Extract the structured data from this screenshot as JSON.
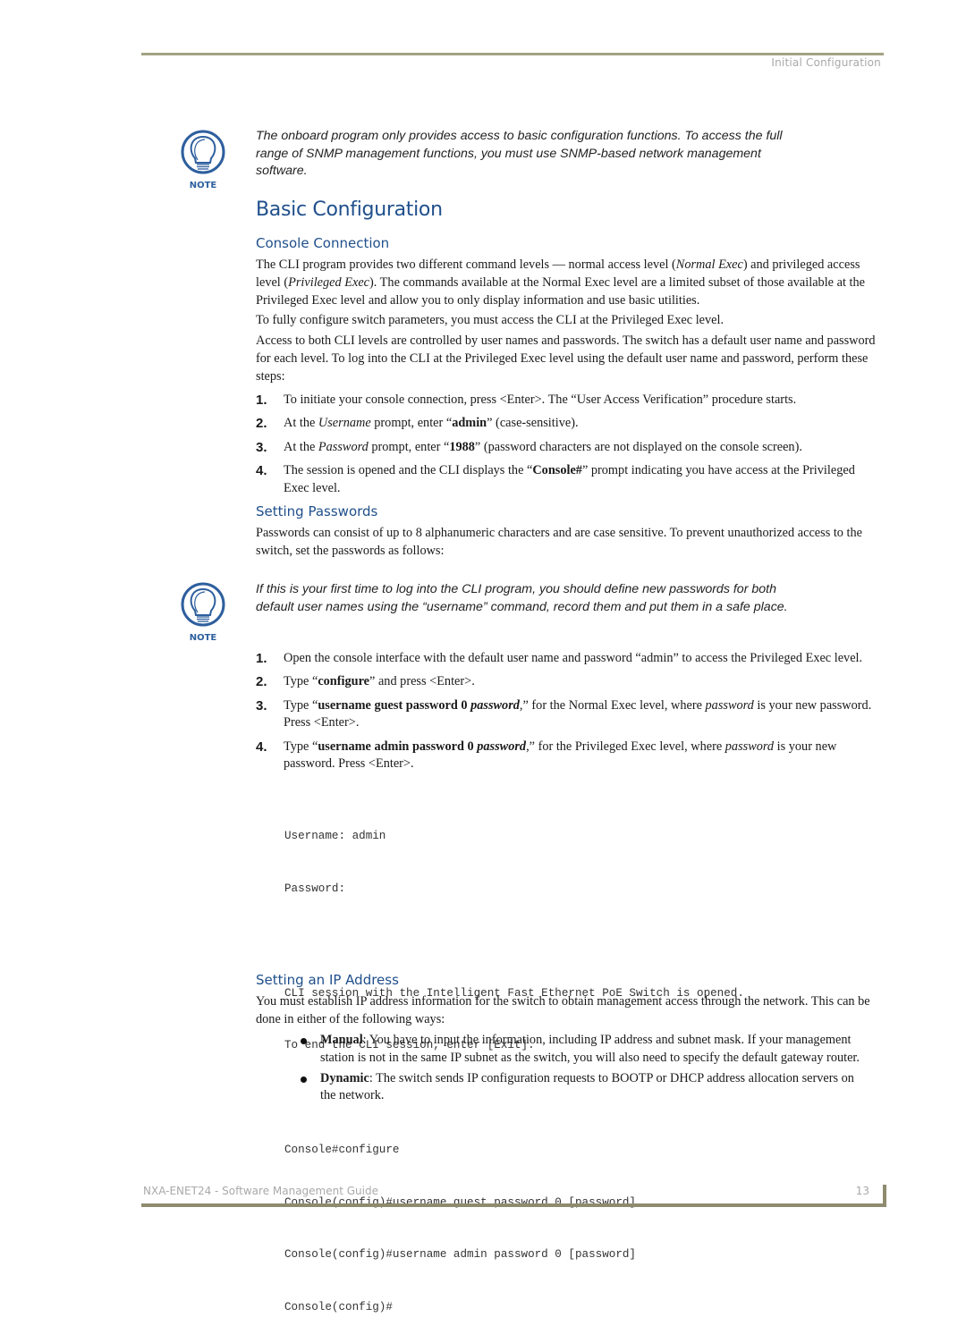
{
  "header": {
    "running_head": "Initial Configuration"
  },
  "note1": {
    "icon": "lightbulb-note-icon",
    "icon_label": "NOTE",
    "text": "The onboard program only provides access to basic configuration functions. To access the full range of SNMP management functions, you must use SNMP-based network management software."
  },
  "section": {
    "title": "Basic Configuration"
  },
  "console_connection": {
    "heading": "Console Connection",
    "para1": {
      "a": "The CLI program provides two different command levels — normal access level (",
      "b": "Normal Exec",
      "c": ") and privileged access level (",
      "d": "Privileged Exec",
      "e": "). The commands available at the Normal Exec level are a limited subset of those available at the Privileged Exec level and allow you to only display information and use basic utilities."
    },
    "para2": "To fully configure switch parameters, you must access the CLI at the Privileged Exec level.",
    "para3": "Access to both CLI levels are controlled by user names and passwords. The switch has a default user name and password for each level. To log into the CLI at the Privileged Exec level using the default user name and password, perform these steps:",
    "steps": [
      {
        "num": "1.",
        "text": "To initiate your console connection, press <Enter>. The “User Access Verification” procedure starts."
      },
      {
        "num": "2.",
        "a": "At the ",
        "b": "Username",
        "c": " prompt, enter “",
        "d": "admin",
        "e": "” (case-sensitive)."
      },
      {
        "num": "3.",
        "a": "At the ",
        "b": "Password",
        "c": " prompt, enter “",
        "d": "1988",
        "e": "” (password characters are not displayed on the console screen)."
      },
      {
        "num": "4.",
        "a": "The session is opened and the CLI displays the “",
        "b": "Console#",
        "c": "” prompt indicating you have access at the Privileged Exec level."
      }
    ]
  },
  "setting_passwords": {
    "heading": "Setting Passwords",
    "para": "Passwords can consist of up to 8 alphanumeric characters and are case sensitive. To prevent unauthorized access to the switch, set the passwords as follows:",
    "note": {
      "icon": "lightbulb-note-icon",
      "icon_label": "NOTE",
      "text": "If this is your first time to log into the CLI program, you should define new passwords for both default user names using the “username” command, record them and put them in a safe place."
    },
    "steps": [
      {
        "num": "1.",
        "text": "Open the console interface with the default user name and password “admin” to access the Privileged Exec level."
      },
      {
        "num": "2.",
        "a": "Type “",
        "b": "configure",
        "c": "” and press <Enter>."
      },
      {
        "num": "3.",
        "a": "Type “",
        "b": "username guest password 0 ",
        "c": "password",
        "d": ",” for the Normal Exec level, where ",
        "e": "password",
        "f": " is your new password. Press <Enter>."
      },
      {
        "num": "4.",
        "a": "Type “",
        "b": "username admin password 0 ",
        "c": "password",
        "d": ",” for the Privileged Exec level, where ",
        "e": "password",
        "f": " is your new password. Press <Enter>."
      }
    ],
    "code": [
      "Username: admin",
      "Password:",
      "",
      "CLI session with the Intelligent Fast Ethernet PoE Switch is opened.",
      "To end the CLI session, enter [Exit].",
      "",
      "Console#configure",
      "Console(config)#username guest password 0 [password]",
      "Console(config)#username admin password 0 [password]",
      "Console(config)#"
    ]
  },
  "setting_ip": {
    "heading": "Setting an IP Address",
    "para": "You must establish IP address information for the switch to obtain management access through the network. This can be done in either of the following ways:",
    "bullets": [
      {
        "label": "Manual",
        "text": ": You have to input the information, including IP address and subnet mask. If your management station is not in the same IP subnet as the switch, you will also need to specify the default gateway router."
      },
      {
        "label": "Dynamic",
        "text": ": The switch sends IP configuration requests to BOOTP or DHCP address allocation servers on the network."
      }
    ]
  },
  "footer": {
    "title": "NXA-ENET24 - Software Management Guide",
    "page": "13"
  },
  "colors": {
    "heading": "#1f4f8b",
    "rule": "#a3a283",
    "footer_rule": "#8f8b6e",
    "running_text": "#a9a9a9",
    "icon": "#2e5f9e"
  }
}
